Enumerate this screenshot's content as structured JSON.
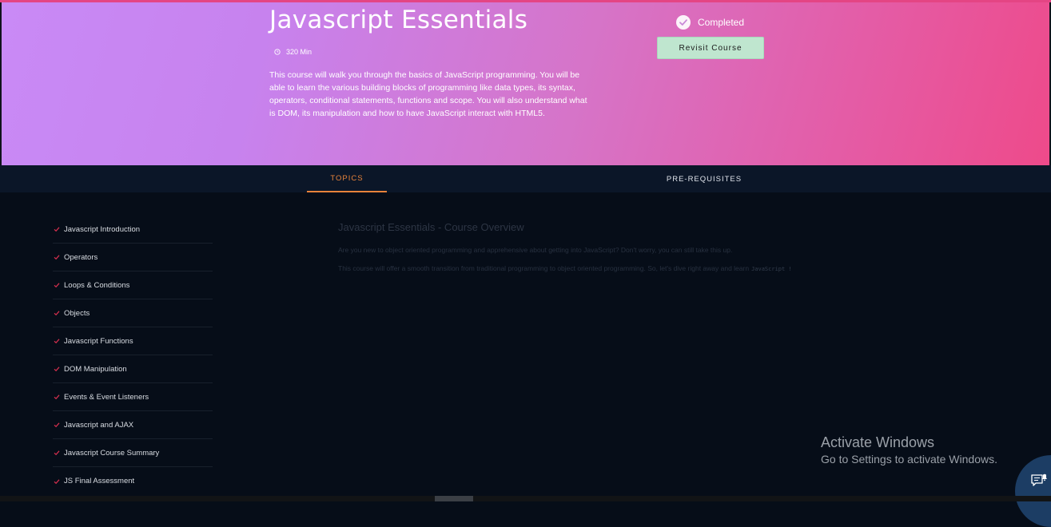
{
  "course": {
    "title": "Javascript Essentials",
    "duration": "320 Min",
    "description": "This course will walk you through the basics of JavaScript programming. You will be able to learn the various building blocks of programming like data types, its syntax, operators, conditional statements, functions and scope. You will also understand what is DOM, its manipulation and how to have JavaScript interact with HTML5.",
    "status": "Completed",
    "revisit_label": "Revisit Course"
  },
  "tabs": [
    {
      "label": "TOPICS",
      "active": true
    },
    {
      "label": "PRE-REQUISITES",
      "active": false
    }
  ],
  "topics": [
    "Javascript Introduction",
    "Operators",
    "Loops & Conditions",
    "Objects",
    "Javascript Functions",
    "DOM Manipulation",
    "Events & Event Listeners",
    "Javascript and AJAX",
    "Javascript Course Summary",
    "JS Final Assessment"
  ],
  "overview": {
    "title": "Javascript Essentials - Course Overview",
    "paragraph1": "Are you new to object oriented programming and apprehensive about getting into JavaScript? Don't worry, you can still take this up.",
    "paragraph2": "This course will offer a smooth transition from traditional programming to object oriented programming. So, let's dive right away and learn",
    "paragraph2_code": "JavaScript !"
  },
  "watermark": {
    "title": "Activate Windows",
    "subtitle": "Go to Settings to activate Windows."
  },
  "colors": {
    "accent_orange": "#e8833a",
    "check_red": "#d9304f",
    "button_green": "#bfe6cf",
    "hero_start": "#c98af6",
    "hero_end": "#ee4a8a",
    "page_bg": "#060d18"
  },
  "icons": {
    "duration": "clock-icon",
    "status": "check-circle-icon",
    "topic": "check-icon",
    "chat": "chat-bell-icon"
  }
}
